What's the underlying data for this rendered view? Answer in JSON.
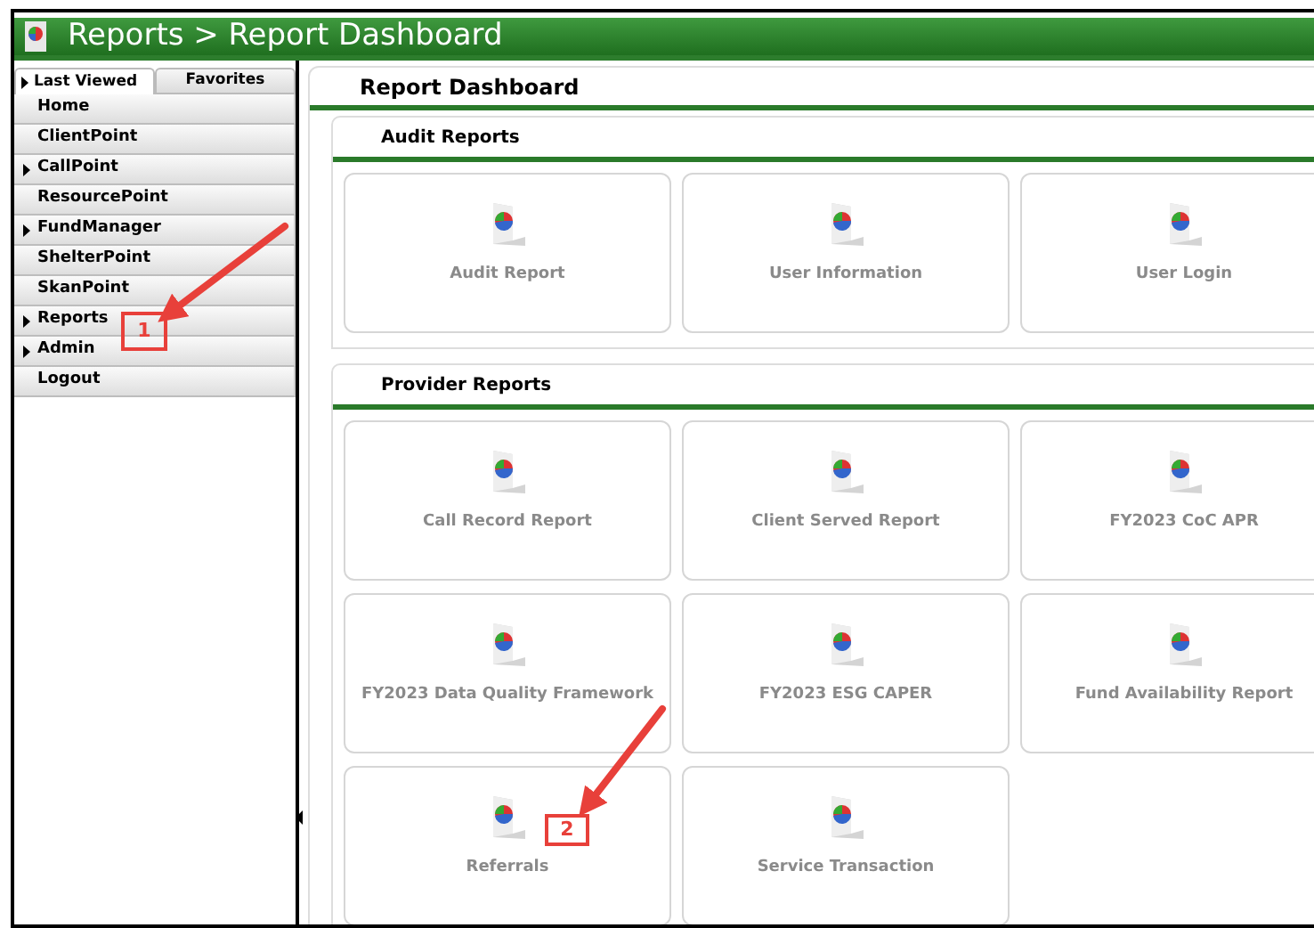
{
  "window": {
    "title": "Reports > Report Dashboard"
  },
  "sidebar": {
    "tabs": [
      {
        "label": "Last Viewed",
        "has_arrow": true,
        "selected": true
      },
      {
        "label": "Favorites",
        "has_arrow": false,
        "selected": false
      }
    ],
    "items": [
      {
        "label": "Home",
        "has_arrow": false
      },
      {
        "label": "ClientPoint",
        "has_arrow": false
      },
      {
        "label": "CallPoint",
        "has_arrow": true
      },
      {
        "label": "ResourcePoint",
        "has_arrow": false
      },
      {
        "label": "FundManager",
        "has_arrow": true
      },
      {
        "label": "ShelterPoint",
        "has_arrow": false
      },
      {
        "label": "SkanPoint",
        "has_arrow": false
      },
      {
        "label": "Reports",
        "has_arrow": true
      },
      {
        "label": "Admin",
        "has_arrow": true
      },
      {
        "label": "Logout",
        "has_arrow": false
      }
    ]
  },
  "main": {
    "header": "Report Dashboard",
    "sections": [
      {
        "title": "Audit Reports",
        "reports": [
          "Audit Report",
          "User Information",
          "User Login"
        ]
      },
      {
        "title": "Provider Reports",
        "reports": [
          "Call Record Report",
          "Client Served Report",
          "FY2023 CoC APR",
          "FY2023 Data Quality Framework",
          "FY2023 ESG CAPER",
          "Fund Availability Report",
          "Referrals",
          "Service Transaction"
        ]
      }
    ]
  },
  "annotations": [
    {
      "label": "1"
    },
    {
      "label": "2"
    }
  ]
}
